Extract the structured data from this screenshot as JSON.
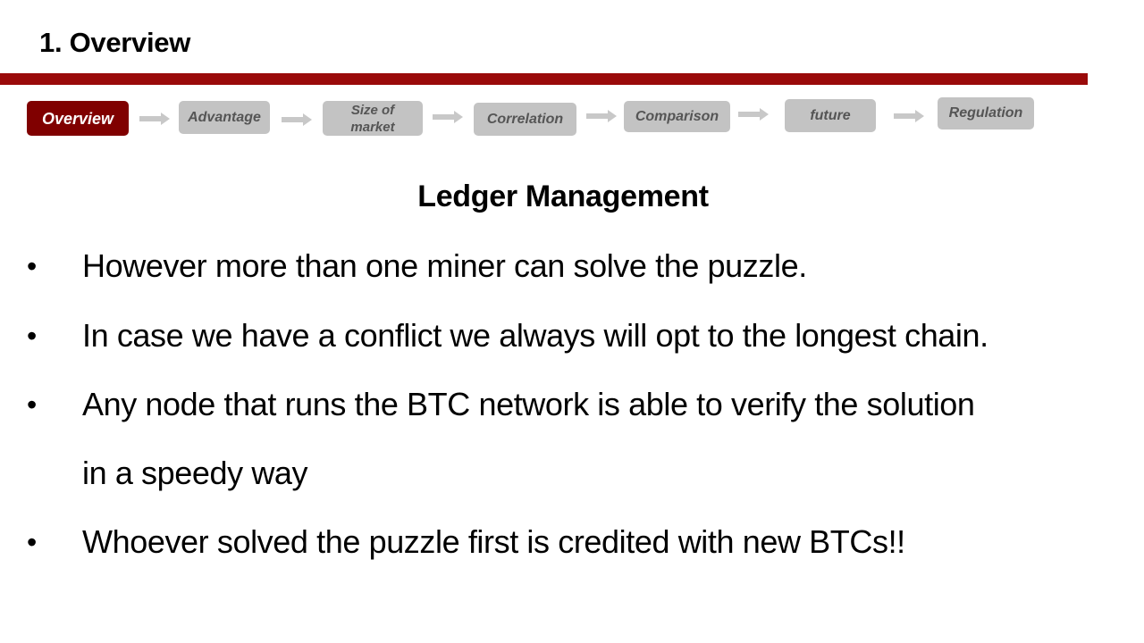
{
  "header": {
    "section_title": "1. Overview"
  },
  "colors": {
    "accent_red": "#9a0a0a",
    "active_step": "#800000",
    "inactive_step": "#c3c3c3",
    "inactive_text": "#555555",
    "arrow": "#c8c8c8"
  },
  "nav": {
    "steps": [
      {
        "label": "Overview",
        "active": true
      },
      {
        "label": "Advantage",
        "active": false
      },
      {
        "label": "Size of market",
        "line1": "Size of",
        "line2": "market",
        "active": false
      },
      {
        "label": "Correlation",
        "active": false
      },
      {
        "label": "Comparison",
        "active": false
      },
      {
        "label": "future",
        "active": false
      },
      {
        "label": "Regulation",
        "active": false
      }
    ],
    "arrow_icon": "right-arrow-icon"
  },
  "slide": {
    "heading": "Ledger Management",
    "bullet_glyph": "•",
    "bullets": [
      {
        "text": "However more than one miner can solve the puzzle."
      },
      {
        "text": "In case we have a conflict we always will opt to the longest chain."
      },
      {
        "text": "Any node that runs the BTC network is able to verify the solution",
        "continuation": "in a speedy way"
      },
      {
        "text": "Whoever solved the puzzle first is credited with new BTCs!!"
      }
    ]
  }
}
